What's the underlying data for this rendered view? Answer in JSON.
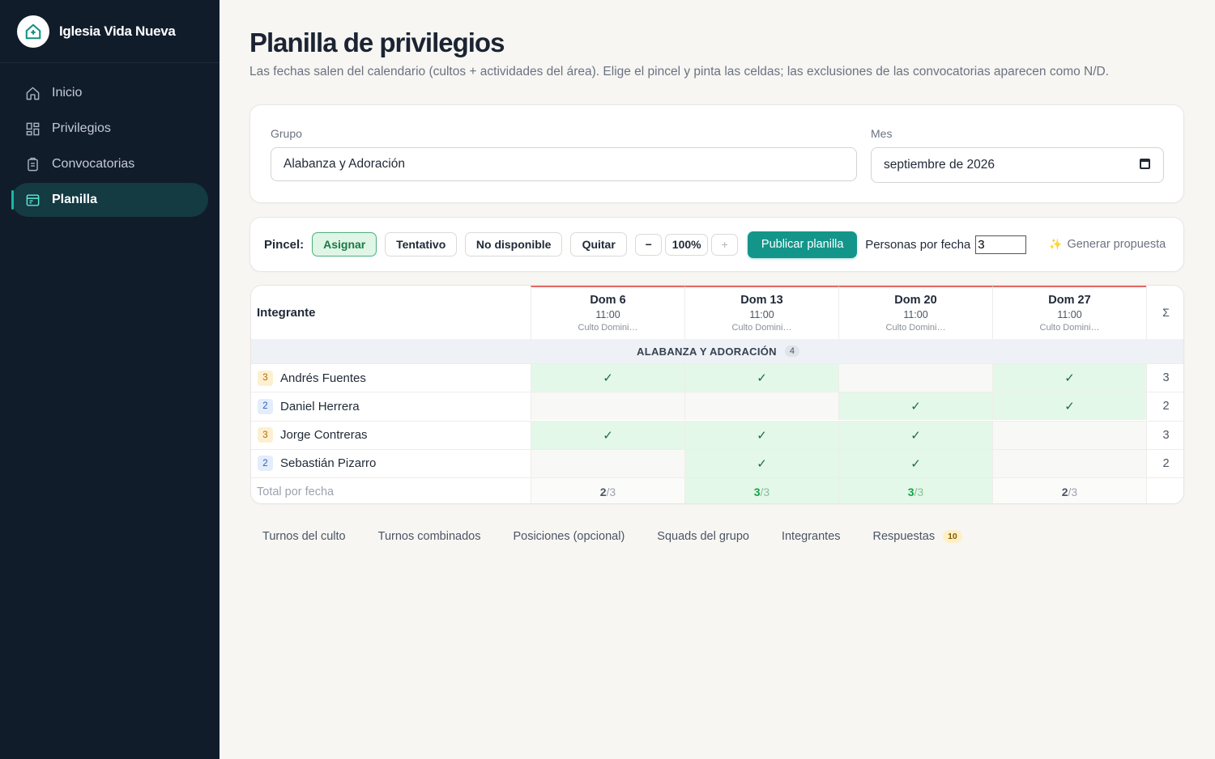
{
  "app": {
    "name": "Iglesia Vida Nueva",
    "logo_icon": "church-house-icon"
  },
  "sidebar": {
    "items": [
      {
        "label": "Inicio",
        "icon": "home-icon",
        "active": false
      },
      {
        "label": "Privilegios",
        "icon": "grid-icon",
        "active": false
      },
      {
        "label": "Convocatorias",
        "icon": "clipboard-icon",
        "active": false
      },
      {
        "label": "Planilla",
        "icon": "calendar-table-icon",
        "active": true
      }
    ]
  },
  "page": {
    "title": "Planilla de privilegios",
    "subtitle": "Las fechas salen del calendario (cultos + actividades del área). Elige el pincel y pinta las celdas; las exclusiones de las convocatorias aparecen como N/D."
  },
  "filters": {
    "group_label": "Grupo",
    "group_value": "Alabanza y Adoración",
    "month_label": "Mes",
    "month_value": "septiembre de 2026"
  },
  "toolbar": {
    "brush_label": "Pincel:",
    "brushes": [
      "Asignar",
      "Tentativo",
      "No disponible",
      "Quitar"
    ],
    "selected_brush": "Asignar",
    "zoom_out": "−",
    "zoom": "100%",
    "zoom_in": "+",
    "publish": "Publicar planilla",
    "per_date_label": "Personas por fecha",
    "per_date_value": "3",
    "generate": "Generar propuesta"
  },
  "grid": {
    "member_header": "Integrante",
    "sum_header": "Σ",
    "dates": [
      {
        "day": "Dom 6",
        "time": "11:00",
        "name": "Culto Domini…"
      },
      {
        "day": "Dom 13",
        "time": "11:00",
        "name": "Culto Domini…"
      },
      {
        "day": "Dom 20",
        "time": "11:00",
        "name": "Culto Domini…"
      },
      {
        "day": "Dom 27",
        "time": "11:00",
        "name": "Culto Domini…"
      }
    ],
    "section": {
      "label": "ALABANZA Y ADORACIÓN",
      "count": "4"
    },
    "members": [
      {
        "name": "Andrés Fuentes",
        "badge": "3",
        "badge_color": "gold",
        "cells": [
          true,
          true,
          false,
          true
        ],
        "sum": "3"
      },
      {
        "name": "Daniel Herrera",
        "badge": "2",
        "badge_color": "blue",
        "cells": [
          false,
          false,
          true,
          true
        ],
        "sum": "2"
      },
      {
        "name": "Jorge Contreras",
        "badge": "3",
        "badge_color": "gold",
        "cells": [
          true,
          true,
          true,
          false
        ],
        "sum": "3"
      },
      {
        "name": "Sebastián Pizarro",
        "badge": "2",
        "badge_color": "blue",
        "cells": [
          false,
          true,
          true,
          false
        ],
        "sum": "2"
      }
    ],
    "total_label": "Total por fecha",
    "totals": [
      {
        "count": "2",
        "of": "/3"
      },
      {
        "count": "3",
        "of": "/3"
      },
      {
        "count": "3",
        "of": "/3"
      },
      {
        "count": "2",
        "of": "/3"
      }
    ]
  },
  "tabs": [
    {
      "label": "Turnos del culto"
    },
    {
      "label": "Turnos combinados"
    },
    {
      "label": "Posiciones (opcional)"
    },
    {
      "label": "Squads del grupo"
    },
    {
      "label": "Integrantes"
    },
    {
      "label": "Respuestas",
      "badge": "10"
    }
  ],
  "colors": {
    "accent": "#14958a",
    "sidebar_bg": "#111c2b",
    "assigned_bg": "#e3f8e9"
  }
}
